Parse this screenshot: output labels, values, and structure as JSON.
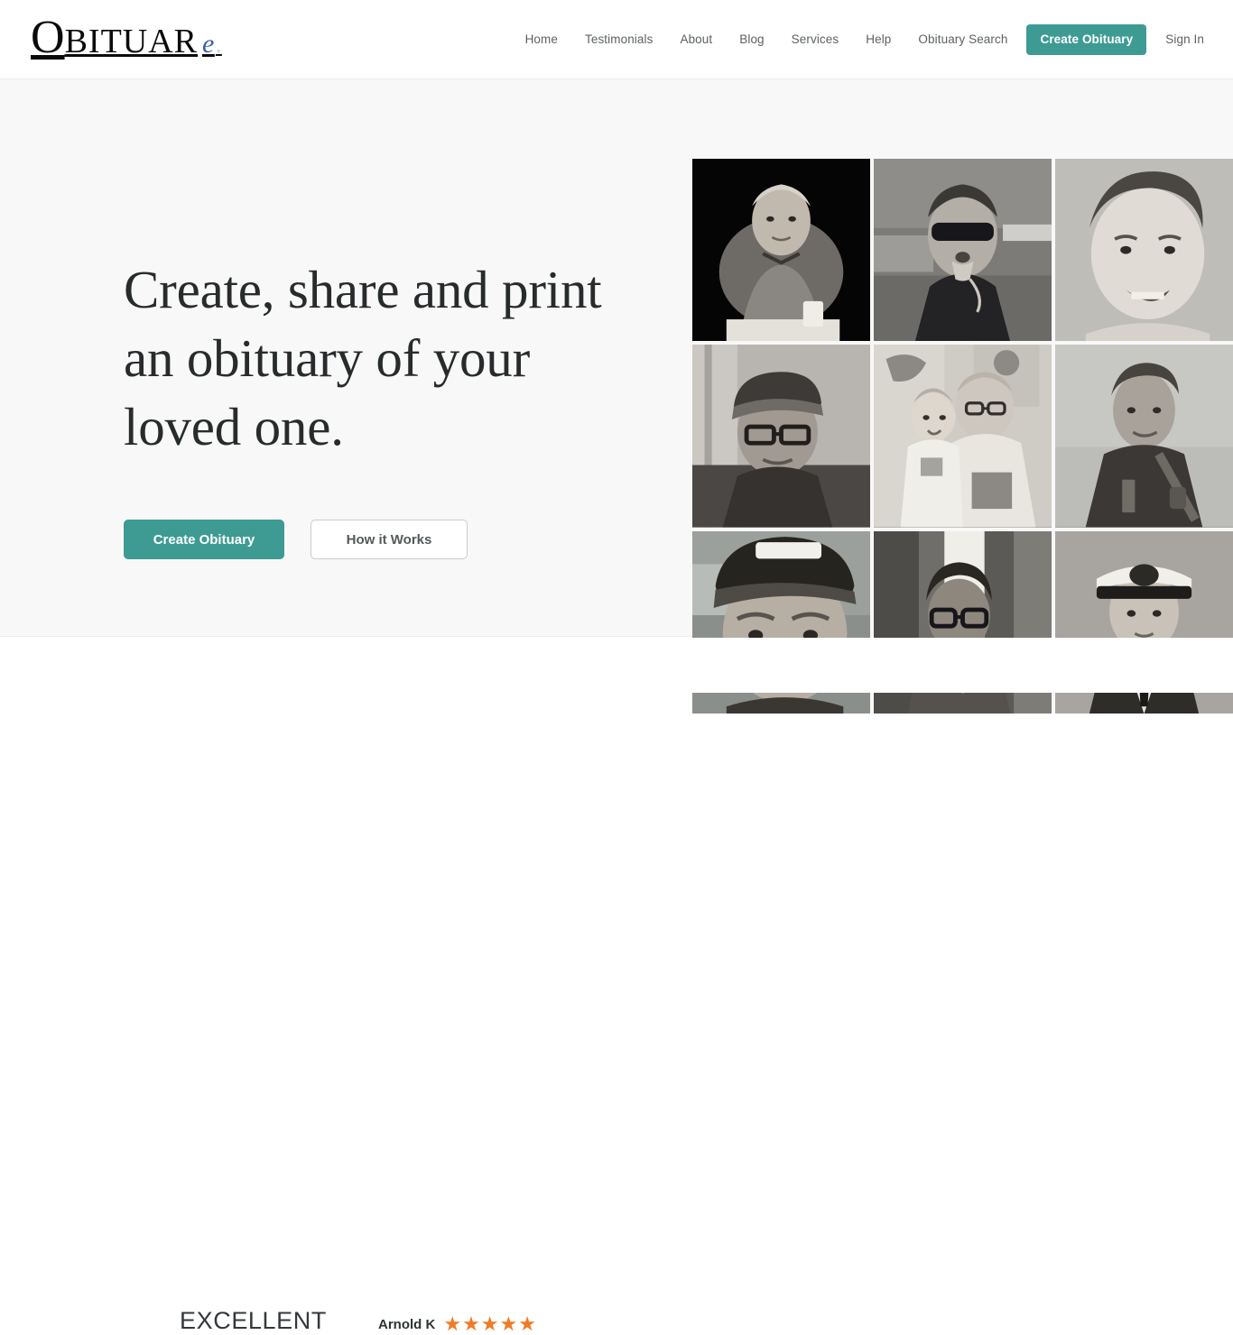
{
  "brand": {
    "logo_initial": "O",
    "logo_main": "BITUAR",
    "logo_accent": "e",
    "logo_dot": ".",
    "accent_color": "#3e9b94",
    "logo_accent_color": "#3b5ca8",
    "star_color": "#f07b26",
    "hero_bg": "#f8f8f8"
  },
  "nav": {
    "items": [
      {
        "label": "Home"
      },
      {
        "label": "Testimonials"
      },
      {
        "label": "About"
      },
      {
        "label": "Blog"
      },
      {
        "label": "Services"
      },
      {
        "label": "Help"
      },
      {
        "label": "Obituary Search"
      }
    ],
    "cta_label": "Create Obituary",
    "signin_label": "Sign In"
  },
  "hero": {
    "headline": "Create, share and print an obituary of your loved one.",
    "primary_button": "Create Obituary",
    "secondary_button": "How it Works",
    "photos": [
      {
        "alt": "elderly-woman-at-table",
        "tone": "dark"
      },
      {
        "alt": "man-with-sunglasses",
        "tone": "mid"
      },
      {
        "alt": "young-man-portrait",
        "tone": "light"
      },
      {
        "alt": "man-with-cap-and-glasses",
        "tone": "mid"
      },
      {
        "alt": "man-holding-toddler",
        "tone": "light"
      },
      {
        "alt": "man-with-shoulder-strap",
        "tone": "mid"
      },
      {
        "alt": "man-with-texans-cap",
        "tone": "mid"
      },
      {
        "alt": "man-with-glasses-outdoors",
        "tone": "mid"
      },
      {
        "alt": "navy-officer-in-uniform",
        "tone": "light"
      }
    ]
  },
  "review": {
    "rating_word": "EXCELLENT",
    "reviewer_name": "Arnold K",
    "stars": "★★★★★",
    "star_count": 5
  }
}
